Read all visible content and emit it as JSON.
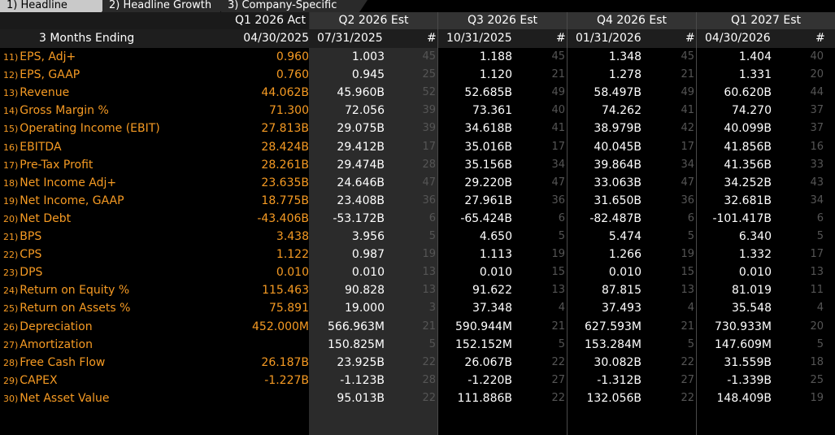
{
  "tabs": [
    {
      "label": "1) Headline",
      "active": true
    },
    {
      "label": "2) Headline Growth",
      "active": false
    },
    {
      "label": "3) Company-Specific",
      "active": false
    }
  ],
  "header": {
    "period_label": "3 Months Ending",
    "count_symbol": "#",
    "columns": [
      {
        "title": "Q1 2026 Act",
        "date": "04/30/2025"
      },
      {
        "title": "Q2 2026 Est",
        "date": "07/31/2025"
      },
      {
        "title": "Q3 2026 Est",
        "date": "10/31/2025"
      },
      {
        "title": "Q4 2026 Est",
        "date": "01/31/2026"
      },
      {
        "title": "Q1 2027 Est",
        "date": "04/30/2026"
      }
    ]
  },
  "rows": [
    {
      "num": "11)",
      "label": "EPS, Adj+",
      "act": "0.960",
      "est": [
        "1.003",
        "1.188",
        "1.348",
        "1.404"
      ],
      "cnt": [
        "45",
        "45",
        "45",
        "40"
      ]
    },
    {
      "num": "12)",
      "label": "EPS, GAAP",
      "act": "0.760",
      "est": [
        "0.945",
        "1.120",
        "1.278",
        "1.331"
      ],
      "cnt": [
        "25",
        "21",
        "21",
        "20"
      ]
    },
    {
      "num": "13)",
      "label": "Revenue",
      "act": "44.062B",
      "est": [
        "45.960B",
        "52.685B",
        "58.497B",
        "60.620B"
      ],
      "cnt": [
        "52",
        "49",
        "49",
        "44"
      ]
    },
    {
      "num": "14)",
      "label": "Gross Margin %",
      "act": "71.300",
      "est": [
        "72.056",
        "73.361",
        "74.262",
        "74.270"
      ],
      "cnt": [
        "39",
        "40",
        "41",
        "37"
      ]
    },
    {
      "num": "15)",
      "label": "Operating Income (EBIT)",
      "act": "27.813B",
      "est": [
        "29.075B",
        "34.618B",
        "38.979B",
        "40.099B"
      ],
      "cnt": [
        "39",
        "41",
        "42",
        "37"
      ]
    },
    {
      "num": "16)",
      "label": "EBITDA",
      "act": "28.424B",
      "est": [
        "29.412B",
        "35.016B",
        "40.045B",
        "41.856B"
      ],
      "cnt": [
        "17",
        "17",
        "17",
        "16"
      ]
    },
    {
      "num": "17)",
      "label": "Pre-Tax Profit",
      "act": "28.261B",
      "est": [
        "29.474B",
        "35.156B",
        "39.864B",
        "41.356B"
      ],
      "cnt": [
        "28",
        "34",
        "34",
        "33"
      ]
    },
    {
      "num": "18)",
      "label": "Net Income Adj+",
      "act": "23.635B",
      "est": [
        "24.646B",
        "29.220B",
        "33.063B",
        "34.252B"
      ],
      "cnt": [
        "47",
        "47",
        "47",
        "43"
      ]
    },
    {
      "num": "19)",
      "label": "Net Income, GAAP",
      "act": "18.775B",
      "est": [
        "23.408B",
        "27.961B",
        "31.650B",
        "32.681B"
      ],
      "cnt": [
        "36",
        "36",
        "36",
        "34"
      ]
    },
    {
      "num": "20)",
      "label": "Net Debt",
      "act": "-43.406B",
      "est": [
        "-53.172B",
        "-65.424B",
        "-82.487B",
        "-101.417B"
      ],
      "cnt": [
        "6",
        "6",
        "6",
        "6"
      ]
    },
    {
      "num": "21)",
      "label": "BPS",
      "act": "3.438",
      "est": [
        "3.956",
        "4.650",
        "5.474",
        "6.340"
      ],
      "cnt": [
        "5",
        "5",
        "5",
        "5"
      ]
    },
    {
      "num": "22)",
      "label": "CPS",
      "act": "1.122",
      "est": [
        "0.987",
        "1.113",
        "1.266",
        "1.332"
      ],
      "cnt": [
        "19",
        "19",
        "19",
        "17"
      ]
    },
    {
      "num": "23)",
      "label": "DPS",
      "act": "0.010",
      "est": [
        "0.010",
        "0.010",
        "0.010",
        "0.010"
      ],
      "cnt": [
        "13",
        "15",
        "15",
        "13"
      ]
    },
    {
      "num": "24)",
      "label": "Return on Equity %",
      "act": "115.463",
      "est": [
        "90.828",
        "91.622",
        "87.815",
        "81.019"
      ],
      "cnt": [
        "13",
        "13",
        "13",
        "11"
      ]
    },
    {
      "num": "25)",
      "label": "Return on Assets %",
      "act": "75.891",
      "est": [
        "19.000",
        "37.348",
        "37.493",
        "35.548"
      ],
      "cnt": [
        "3",
        "4",
        "4",
        "4"
      ]
    },
    {
      "num": "26)",
      "label": "Depreciation",
      "act": "452.000M",
      "est": [
        "566.963M",
        "590.944M",
        "627.593M",
        "730.933M"
      ],
      "cnt": [
        "21",
        "21",
        "21",
        "20"
      ]
    },
    {
      "num": "27)",
      "label": "Amortization",
      "act": "",
      "est": [
        "150.825M",
        "152.152M",
        "153.284M",
        "147.609M"
      ],
      "cnt": [
        "5",
        "5",
        "5",
        "5"
      ]
    },
    {
      "num": "28)",
      "label": "Free Cash Flow",
      "act": "26.187B",
      "est": [
        "23.925B",
        "26.067B",
        "30.082B",
        "31.559B"
      ],
      "cnt": [
        "22",
        "22",
        "22",
        "18"
      ]
    },
    {
      "num": "29)",
      "label": "CAPEX",
      "act": "-1.227B",
      "est": [
        "-1.123B",
        "-1.220B",
        "-1.312B",
        "-1.339B"
      ],
      "cnt": [
        "28",
        "27",
        "27",
        "25"
      ]
    },
    {
      "num": "30)",
      "label": "Net Asset Value",
      "act": "",
      "est": [
        "95.013B",
        "111.886B",
        "132.056B",
        "148.409B"
      ],
      "cnt": [
        "22",
        "22",
        "22",
        "19"
      ]
    }
  ],
  "colors": {
    "label": "#f59a23",
    "value": "#ffffff",
    "count": "#555555",
    "highlight_col": "#2b2b2b"
  }
}
